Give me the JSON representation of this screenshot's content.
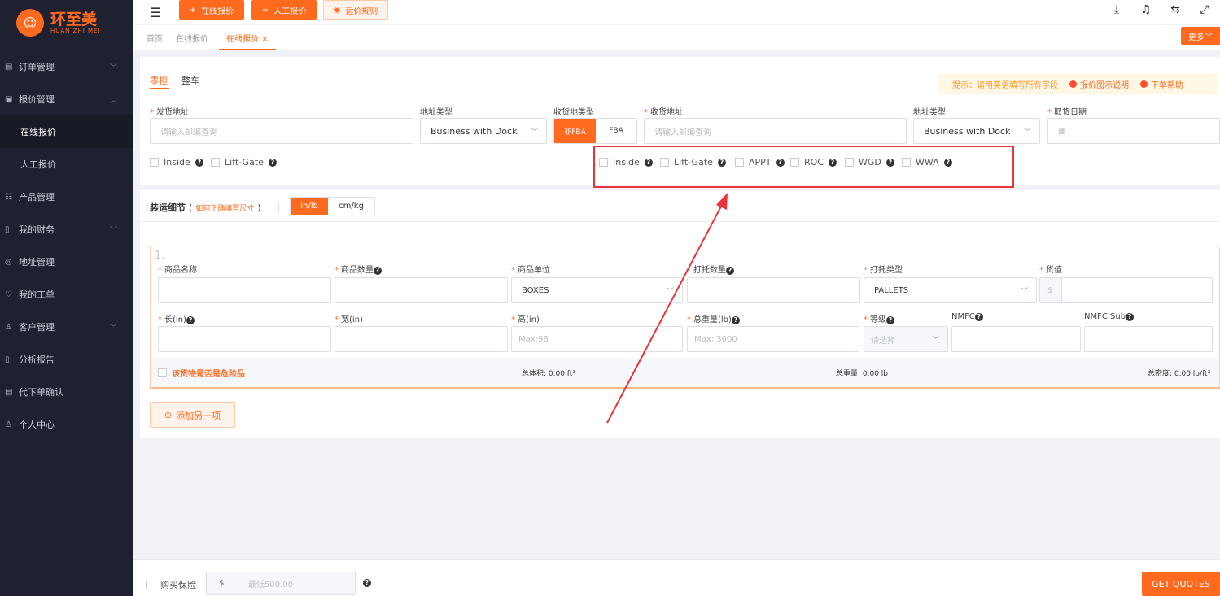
{
  "brand": {
    "name": "环至美",
    "sub": "HUAN ZHI MEI",
    "accent": "#ff6a1f",
    "sidebar_bg": "#1f2130",
    "annotation": "#e8343a"
  },
  "topbar": {
    "btn_online": "在线报价",
    "btn_manual": "人工报价",
    "btn_rules": "运价规则",
    "icons": [
      "download-icon",
      "bell-icon",
      "translate-icon",
      "fullscreen-icon"
    ]
  },
  "sidebar": {
    "items": [
      {
        "label": "订单管理",
        "icon": "order-icon",
        "chevron": "down"
      },
      {
        "label": "报价管理",
        "icon": "quote-icon",
        "chevron": "up"
      },
      {
        "label": "在线报价",
        "sub": true,
        "active": true
      },
      {
        "label": "人工报价",
        "sub": true
      },
      {
        "label": "产品管理",
        "icon": "product-icon"
      },
      {
        "label": "我的财务",
        "icon": "finance-icon",
        "chevron": "down"
      },
      {
        "label": "地址管理",
        "icon": "address-icon"
      },
      {
        "label": "我的工单",
        "icon": "ticket-icon"
      },
      {
        "label": "客户管理",
        "icon": "customer-icon",
        "chevron": "down"
      },
      {
        "label": "分析报告",
        "icon": "report-icon"
      },
      {
        "label": "代下单确认",
        "icon": "confirm-icon"
      },
      {
        "label": "个人中心",
        "icon": "user-icon"
      }
    ]
  },
  "breadcrumbs": {
    "home": "首页",
    "parent": "在线报价",
    "current": "在线报价",
    "close": "×",
    "more": "更多"
  },
  "tabs": {
    "ltl": "零担",
    "ftl": "整车"
  },
  "tips": {
    "hint": "提示：请用英语填写所有字段",
    "diagram": "报价图示说明",
    "help": "下单帮助"
  },
  "origin": {
    "label": "发货地址",
    "placeholder": "请输入邮编查询",
    "type_label": "地址类型",
    "type_value": "Business with Dock",
    "options": [
      "Inside",
      "Lift-Gate"
    ]
  },
  "dest": {
    "kind_label": "收货地类型",
    "kind_non_fba": "非FBA",
    "kind_fba": "FBA",
    "label": "收货地址",
    "placeholder": "请输入邮编查询",
    "type_label": "地址类型",
    "type_value": "Business with Dock",
    "options": [
      "Inside",
      "Lift-Gate",
      "APPT",
      "ROC",
      "WGD",
      "WWA"
    ]
  },
  "pickup": {
    "label": "取货日期"
  },
  "shipping": {
    "title": "装运细节",
    "paren_open": "(",
    "paren_close": ")",
    "link": "如何正确填写尺寸",
    "unit_imperial": "in/lb",
    "unit_metric": "cm/kg"
  },
  "item": {
    "index": "1.",
    "name_label": "商品名称",
    "qty_label": "商品数量",
    "unit_label": "商品单位",
    "unit_value": "BOXES",
    "pallet_qty_label": "打托数量",
    "pallet_type_label": "打托类型",
    "pallet_type_value": "PALLETS",
    "value_label": "货值",
    "currency": "$",
    "length_label": "长(in)",
    "width_label": "宽(in)",
    "height_label": "高(in)",
    "height_placeholder": "Max:96",
    "weight_label": "总重量(lb)",
    "weight_placeholder": "Max: 3000",
    "class_label": "等级",
    "class_placeholder": "请选择",
    "nmfc_label": "NMFC",
    "nmfc_sub_label": "NMFC Sub",
    "hazmat_label": "该货物是否是危险品",
    "total_volume": "总体积: 0.00 ft³",
    "total_weight": "总重量: 0.00 lb",
    "total_density": "总密度: 0.00 lb/ft³"
  },
  "add_item": "添加另一项",
  "footer": {
    "insurance": "购买保险",
    "currency": "$",
    "min_placeholder": "最低500.00",
    "get_quotes": "GET QUOTES"
  }
}
